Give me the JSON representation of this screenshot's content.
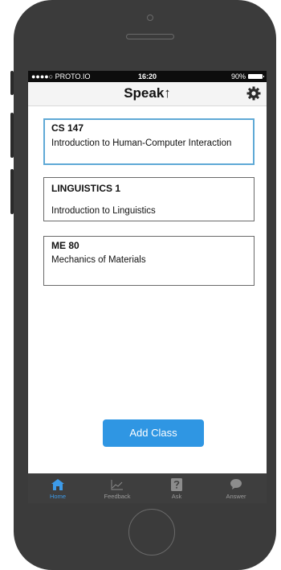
{
  "status_bar": {
    "carrier": "●●●●○ PROTO.IO",
    "time": "16:20",
    "battery": "90%"
  },
  "header": {
    "title": "Speak↑",
    "settings_icon": "gear-icon"
  },
  "classes": [
    {
      "code": "CS 147",
      "name": "Introduction to Human-Computer Interaction",
      "selected": true
    },
    {
      "code": "LINGUISTICS 1",
      "name": "Introduction to Linguistics",
      "selected": false
    },
    {
      "code": "ME 80",
      "name": "Mechanics of Materials",
      "selected": false
    }
  ],
  "add_button": {
    "label": "Add Class"
  },
  "tabs": [
    {
      "label": "Home",
      "icon": "home-icon",
      "active": true
    },
    {
      "label": "Feedback",
      "icon": "chart-icon",
      "active": false
    },
    {
      "label": "Ask",
      "icon": "question-icon",
      "active": false
    },
    {
      "label": "Answer",
      "icon": "speech-bubble-icon",
      "active": false
    }
  ],
  "colors": {
    "accent": "#2f96e3",
    "selected_border": "#5fa9d6",
    "tab_active": "#3d9be9",
    "phone_body": "#3b3b3b"
  }
}
